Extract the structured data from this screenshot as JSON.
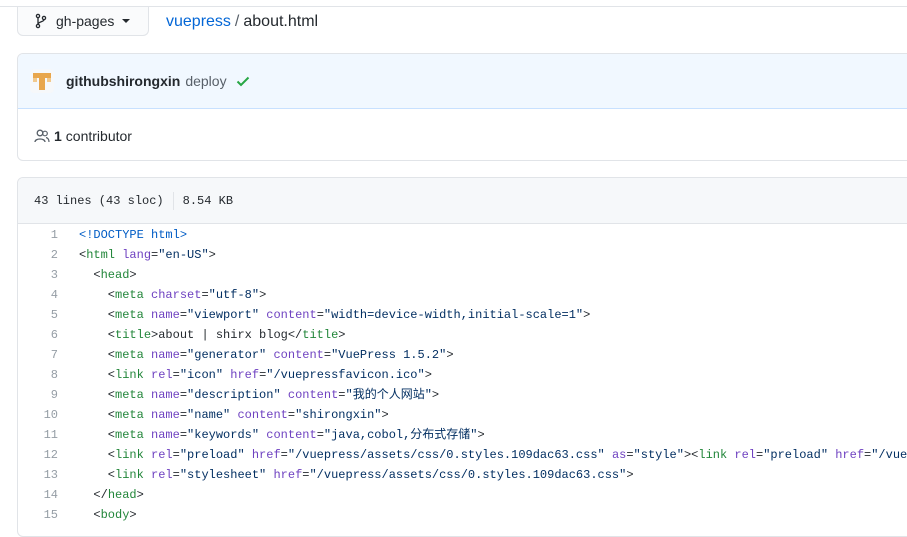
{
  "branch": {
    "name": "gh-pages"
  },
  "breadcrumb": {
    "repo": "vuepress",
    "separator": "/",
    "file": "about.html"
  },
  "commit": {
    "author": "githubshirongxin",
    "message": "deploy"
  },
  "contributors": {
    "count": "1",
    "label": "contributor"
  },
  "file": {
    "lines": "43 lines (43 sloc)",
    "size": "8.54 KB"
  },
  "colors": {
    "link": "#0366d6",
    "tag": "#22863a",
    "attr": "#6f42c1",
    "string": "#032f62",
    "doctype": "#005cc5",
    "check": "#28a745"
  },
  "code": [
    {
      "ln": "1",
      "seg": [
        {
          "c": "d",
          "v": "<!DOCTYPE html>"
        }
      ]
    },
    {
      "ln": "2",
      "seg": [
        {
          "c": "tx",
          "v": "<"
        },
        {
          "c": "t",
          "v": "html"
        },
        {
          "c": "tx",
          "v": " "
        },
        {
          "c": "a",
          "v": "lang"
        },
        {
          "c": "tx",
          "v": "="
        },
        {
          "c": "s",
          "v": "\"en-US\""
        },
        {
          "c": "tx",
          "v": ">"
        }
      ]
    },
    {
      "ln": "3",
      "seg": [
        {
          "c": "tx",
          "v": "  <"
        },
        {
          "c": "t",
          "v": "head"
        },
        {
          "c": "tx",
          "v": ">"
        }
      ]
    },
    {
      "ln": "4",
      "seg": [
        {
          "c": "tx",
          "v": "    <"
        },
        {
          "c": "t",
          "v": "meta"
        },
        {
          "c": "tx",
          "v": " "
        },
        {
          "c": "a",
          "v": "charset"
        },
        {
          "c": "tx",
          "v": "="
        },
        {
          "c": "s",
          "v": "\"utf-8\""
        },
        {
          "c": "tx",
          "v": ">"
        }
      ]
    },
    {
      "ln": "5",
      "seg": [
        {
          "c": "tx",
          "v": "    <"
        },
        {
          "c": "t",
          "v": "meta"
        },
        {
          "c": "tx",
          "v": " "
        },
        {
          "c": "a",
          "v": "name"
        },
        {
          "c": "tx",
          "v": "="
        },
        {
          "c": "s",
          "v": "\"viewport\""
        },
        {
          "c": "tx",
          "v": " "
        },
        {
          "c": "a",
          "v": "content"
        },
        {
          "c": "tx",
          "v": "="
        },
        {
          "c": "s",
          "v": "\"width=device-width,initial-scale=1\""
        },
        {
          "c": "tx",
          "v": ">"
        }
      ]
    },
    {
      "ln": "6",
      "seg": [
        {
          "c": "tx",
          "v": "    <"
        },
        {
          "c": "t",
          "v": "title"
        },
        {
          "c": "tx",
          "v": ">about | shirx blog</"
        },
        {
          "c": "t",
          "v": "title"
        },
        {
          "c": "tx",
          "v": ">"
        }
      ]
    },
    {
      "ln": "7",
      "seg": [
        {
          "c": "tx",
          "v": "    <"
        },
        {
          "c": "t",
          "v": "meta"
        },
        {
          "c": "tx",
          "v": " "
        },
        {
          "c": "a",
          "v": "name"
        },
        {
          "c": "tx",
          "v": "="
        },
        {
          "c": "s",
          "v": "\"generator\""
        },
        {
          "c": "tx",
          "v": " "
        },
        {
          "c": "a",
          "v": "content"
        },
        {
          "c": "tx",
          "v": "="
        },
        {
          "c": "s",
          "v": "\"VuePress 1.5.2\""
        },
        {
          "c": "tx",
          "v": ">"
        }
      ]
    },
    {
      "ln": "8",
      "seg": [
        {
          "c": "tx",
          "v": "    <"
        },
        {
          "c": "t",
          "v": "link"
        },
        {
          "c": "tx",
          "v": " "
        },
        {
          "c": "a",
          "v": "rel"
        },
        {
          "c": "tx",
          "v": "="
        },
        {
          "c": "s",
          "v": "\"icon\""
        },
        {
          "c": "tx",
          "v": " "
        },
        {
          "c": "a",
          "v": "href"
        },
        {
          "c": "tx",
          "v": "="
        },
        {
          "c": "s",
          "v": "\"/vuepressfavicon.ico\""
        },
        {
          "c": "tx",
          "v": ">"
        }
      ]
    },
    {
      "ln": "9",
      "seg": [
        {
          "c": "tx",
          "v": "    <"
        },
        {
          "c": "t",
          "v": "meta"
        },
        {
          "c": "tx",
          "v": " "
        },
        {
          "c": "a",
          "v": "name"
        },
        {
          "c": "tx",
          "v": "="
        },
        {
          "c": "s",
          "v": "\"description\""
        },
        {
          "c": "tx",
          "v": " "
        },
        {
          "c": "a",
          "v": "content"
        },
        {
          "c": "tx",
          "v": "="
        },
        {
          "c": "s",
          "v": "\"我的个人网站\""
        },
        {
          "c": "tx",
          "v": ">"
        }
      ]
    },
    {
      "ln": "10",
      "seg": [
        {
          "c": "tx",
          "v": "    <"
        },
        {
          "c": "t",
          "v": "meta"
        },
        {
          "c": "tx",
          "v": " "
        },
        {
          "c": "a",
          "v": "name"
        },
        {
          "c": "tx",
          "v": "="
        },
        {
          "c": "s",
          "v": "\"name\""
        },
        {
          "c": "tx",
          "v": " "
        },
        {
          "c": "a",
          "v": "content"
        },
        {
          "c": "tx",
          "v": "="
        },
        {
          "c": "s",
          "v": "\"shirongxin\""
        },
        {
          "c": "tx",
          "v": ">"
        }
      ]
    },
    {
      "ln": "11",
      "seg": [
        {
          "c": "tx",
          "v": "    <"
        },
        {
          "c": "t",
          "v": "meta"
        },
        {
          "c": "tx",
          "v": " "
        },
        {
          "c": "a",
          "v": "name"
        },
        {
          "c": "tx",
          "v": "="
        },
        {
          "c": "s",
          "v": "\"keywords\""
        },
        {
          "c": "tx",
          "v": " "
        },
        {
          "c": "a",
          "v": "content"
        },
        {
          "c": "tx",
          "v": "="
        },
        {
          "c": "s",
          "v": "\"java,cobol,分布式存储\""
        },
        {
          "c": "tx",
          "v": ">"
        }
      ]
    },
    {
      "ln": "12",
      "seg": [
        {
          "c": "tx",
          "v": "    <"
        },
        {
          "c": "t",
          "v": "link"
        },
        {
          "c": "tx",
          "v": " "
        },
        {
          "c": "a",
          "v": "rel"
        },
        {
          "c": "tx",
          "v": "="
        },
        {
          "c": "s",
          "v": "\"preload\""
        },
        {
          "c": "tx",
          "v": " "
        },
        {
          "c": "a",
          "v": "href"
        },
        {
          "c": "tx",
          "v": "="
        },
        {
          "c": "s",
          "v": "\"/vuepress/assets/css/0.styles.109dac63.css\""
        },
        {
          "c": "tx",
          "v": " "
        },
        {
          "c": "a",
          "v": "as"
        },
        {
          "c": "tx",
          "v": "="
        },
        {
          "c": "s",
          "v": "\"style\""
        },
        {
          "c": "tx",
          "v": "><"
        },
        {
          "c": "t",
          "v": "link"
        },
        {
          "c": "tx",
          "v": " "
        },
        {
          "c": "a",
          "v": "rel"
        },
        {
          "c": "tx",
          "v": "="
        },
        {
          "c": "s",
          "v": "\"preload\""
        },
        {
          "c": "tx",
          "v": " "
        },
        {
          "c": "a",
          "v": "href"
        },
        {
          "c": "tx",
          "v": "="
        },
        {
          "c": "s",
          "v": "\"/vuepress/asset"
        }
      ]
    },
    {
      "ln": "13",
      "seg": [
        {
          "c": "tx",
          "v": "    <"
        },
        {
          "c": "t",
          "v": "link"
        },
        {
          "c": "tx",
          "v": " "
        },
        {
          "c": "a",
          "v": "rel"
        },
        {
          "c": "tx",
          "v": "="
        },
        {
          "c": "s",
          "v": "\"stylesheet\""
        },
        {
          "c": "tx",
          "v": " "
        },
        {
          "c": "a",
          "v": "href"
        },
        {
          "c": "tx",
          "v": "="
        },
        {
          "c": "s",
          "v": "\"/vuepress/assets/css/0.styles.109dac63.css\""
        },
        {
          "c": "tx",
          "v": ">"
        }
      ]
    },
    {
      "ln": "14",
      "seg": [
        {
          "c": "tx",
          "v": "  </"
        },
        {
          "c": "t",
          "v": "head"
        },
        {
          "c": "tx",
          "v": ">"
        }
      ]
    },
    {
      "ln": "15",
      "seg": [
        {
          "c": "tx",
          "v": "  <"
        },
        {
          "c": "t",
          "v": "body"
        },
        {
          "c": "tx",
          "v": ">"
        }
      ]
    }
  ]
}
